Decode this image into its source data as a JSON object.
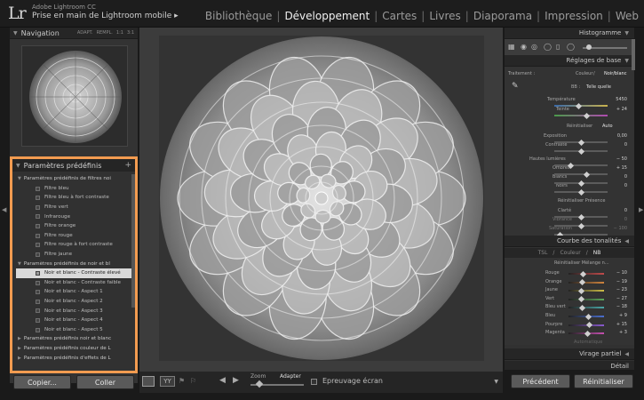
{
  "topbar": {
    "logo": "Lr",
    "app_name": "Adobe Lightroom CC",
    "catalog_name": "Prise en main de Lightroom mobile ▸",
    "modules": [
      {
        "label": "Bibliothèque",
        "active": false
      },
      {
        "label": "Développement",
        "active": true
      },
      {
        "label": "Cartes",
        "active": false
      },
      {
        "label": "Livres",
        "active": false
      },
      {
        "label": "Diaporama",
        "active": false
      },
      {
        "label": "Impression",
        "active": false
      },
      {
        "label": "Web",
        "active": false
      }
    ],
    "separator": "|"
  },
  "navigator": {
    "title": "Navigation",
    "options": [
      "ADAPT.",
      "REMPL.",
      "1:1",
      "3:1"
    ],
    "preview_icon": "succulent-thumbnail"
  },
  "presets": {
    "title": "Paramètres prédéfinis",
    "add_label": "+",
    "rows": [
      {
        "type": "group",
        "label": "Paramètres prédéfinis de filtres noi"
      },
      {
        "type": "item",
        "label": "Filtre bleu"
      },
      {
        "type": "item",
        "label": "Filtre bleu à fort contraste"
      },
      {
        "type": "item",
        "label": "Filtre vert"
      },
      {
        "type": "item",
        "label": "Infrarouge"
      },
      {
        "type": "item",
        "label": "Filtre orange"
      },
      {
        "type": "item",
        "label": "Filtre rouge"
      },
      {
        "type": "item",
        "label": "Filtre rouge à fort contraste"
      },
      {
        "type": "item",
        "label": "Filtre jaune"
      },
      {
        "type": "group",
        "label": "Paramètres prédéfinis de noir et bl"
      },
      {
        "type": "item",
        "label": "Noir et blanc - Contraste élevé",
        "selected": true
      },
      {
        "type": "item",
        "label": "Noir et blanc - Contraste faible"
      },
      {
        "type": "item",
        "label": "Noir et blanc - Aspect 1"
      },
      {
        "type": "item",
        "label": "Noir et blanc - Aspect 2"
      },
      {
        "type": "item",
        "label": "Noir et blanc - Aspect 3"
      },
      {
        "type": "item",
        "label": "Noir et blanc - Aspect 4"
      },
      {
        "type": "item",
        "label": "Noir et blanc - Aspect 5"
      },
      {
        "type": "group",
        "label": "Paramètres prédéfinis noir et blanc"
      },
      {
        "type": "group",
        "label": "Paramètres prédéfinis couleur de L"
      },
      {
        "type": "group",
        "label": "Paramètres prédéfinis d'effets de L"
      }
    ]
  },
  "left_buttons": {
    "copy": "Copier...",
    "paste": "Coller"
  },
  "toolbar": {
    "yy": "YY",
    "zoom_label": "Zoom",
    "zoom_value": "Adapter",
    "softproof": "Epreuvage écran"
  },
  "right_panel": {
    "histogram": "Histogramme",
    "basic": {
      "title": "Réglages de base",
      "treatment_label": "Traitement :",
      "treatment_color": "Couleur",
      "treatment_bw": "Noir/blanc",
      "wb_label": "BB :",
      "wb_value": "Telle quelle",
      "temp_label": "Température",
      "temp_value": "5450",
      "tint_label": "Teinte",
      "tint_value": "+ 24",
      "tone_header": "Réinitialiser",
      "tone_auto": "Auto",
      "exposure_label": "Exposition",
      "exposure_value": "0,00",
      "contrast_label": "Contraste",
      "contrast_value": "0",
      "highlights_label": "Hautes lumières",
      "highlights_value": "− 50",
      "shadows_label": "Ombres",
      "shadows_value": "+ 15",
      "whites_label": "Blancs",
      "whites_value": "0",
      "blacks_label": "Noirs",
      "blacks_value": "0",
      "presence_header": "Réinitialiser Présence",
      "clarity_label": "Clarté",
      "clarity_value": "0",
      "vibrance_label": "Vibrance",
      "vibrance_value": "0",
      "saturation_label": "Saturation",
      "saturation_value": "− 100"
    },
    "tone_curve": "Courbe des tonalités",
    "hsl_tabs": {
      "tsl": "TSL",
      "sep": "/",
      "color": "Couleur",
      "nb": "NB"
    },
    "mix_header": "Réinitialiser Mélange n...",
    "mix": [
      {
        "label": "Rouge",
        "value": "− 10",
        "level": 0.4
      },
      {
        "label": "Orange",
        "value": "− 19",
        "level": 0.38
      },
      {
        "label": "Jaune",
        "value": "− 23",
        "level": 0.36
      },
      {
        "label": "Vert",
        "value": "− 27",
        "level": 0.34
      },
      {
        "label": "Bleu vert",
        "value": "− 18",
        "level": 0.38
      },
      {
        "label": "Bleu",
        "value": "+ 9",
        "level": 0.56
      },
      {
        "label": "Pourpre",
        "value": "+ 15",
        "level": 0.58
      },
      {
        "label": "Magenta",
        "value": "+ 3",
        "level": 0.52
      }
    ],
    "mix_auto": "Automatique",
    "split_toning": "Virage partiel",
    "detail": "Détail"
  },
  "right_buttons": {
    "previous": "Précédent",
    "reset": "Réinitialiser"
  },
  "colors": {
    "highlight": "#f29b50",
    "active_module": "#f0f0f0"
  }
}
